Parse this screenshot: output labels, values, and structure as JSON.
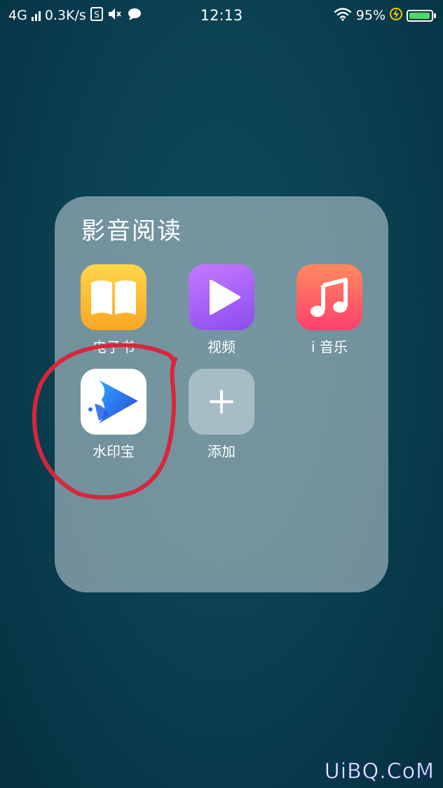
{
  "status_bar": {
    "network": "4G",
    "speed": "0.3K/s",
    "time": "12:13",
    "battery_percent_text": "95%",
    "battery_level": 0.95
  },
  "folder": {
    "title": "影音阅读",
    "apps": [
      {
        "label": "电子书",
        "icon": "book-icon",
        "color": "#f9a623"
      },
      {
        "label": "视频",
        "icon": "play-icon",
        "color": "#8a4dee"
      },
      {
        "label": "i 音乐",
        "icon": "music-note-icon",
        "color": "#ff3f6b"
      },
      {
        "label": "水印宝",
        "icon": "watermark-app-icon",
        "color": "#2f6df0"
      },
      {
        "label": "添加",
        "icon": "plus-icon",
        "color": "#ffffff"
      }
    ]
  },
  "annotation": {
    "color": "#d8263a"
  },
  "watermark": "UiBQ.CoM"
}
